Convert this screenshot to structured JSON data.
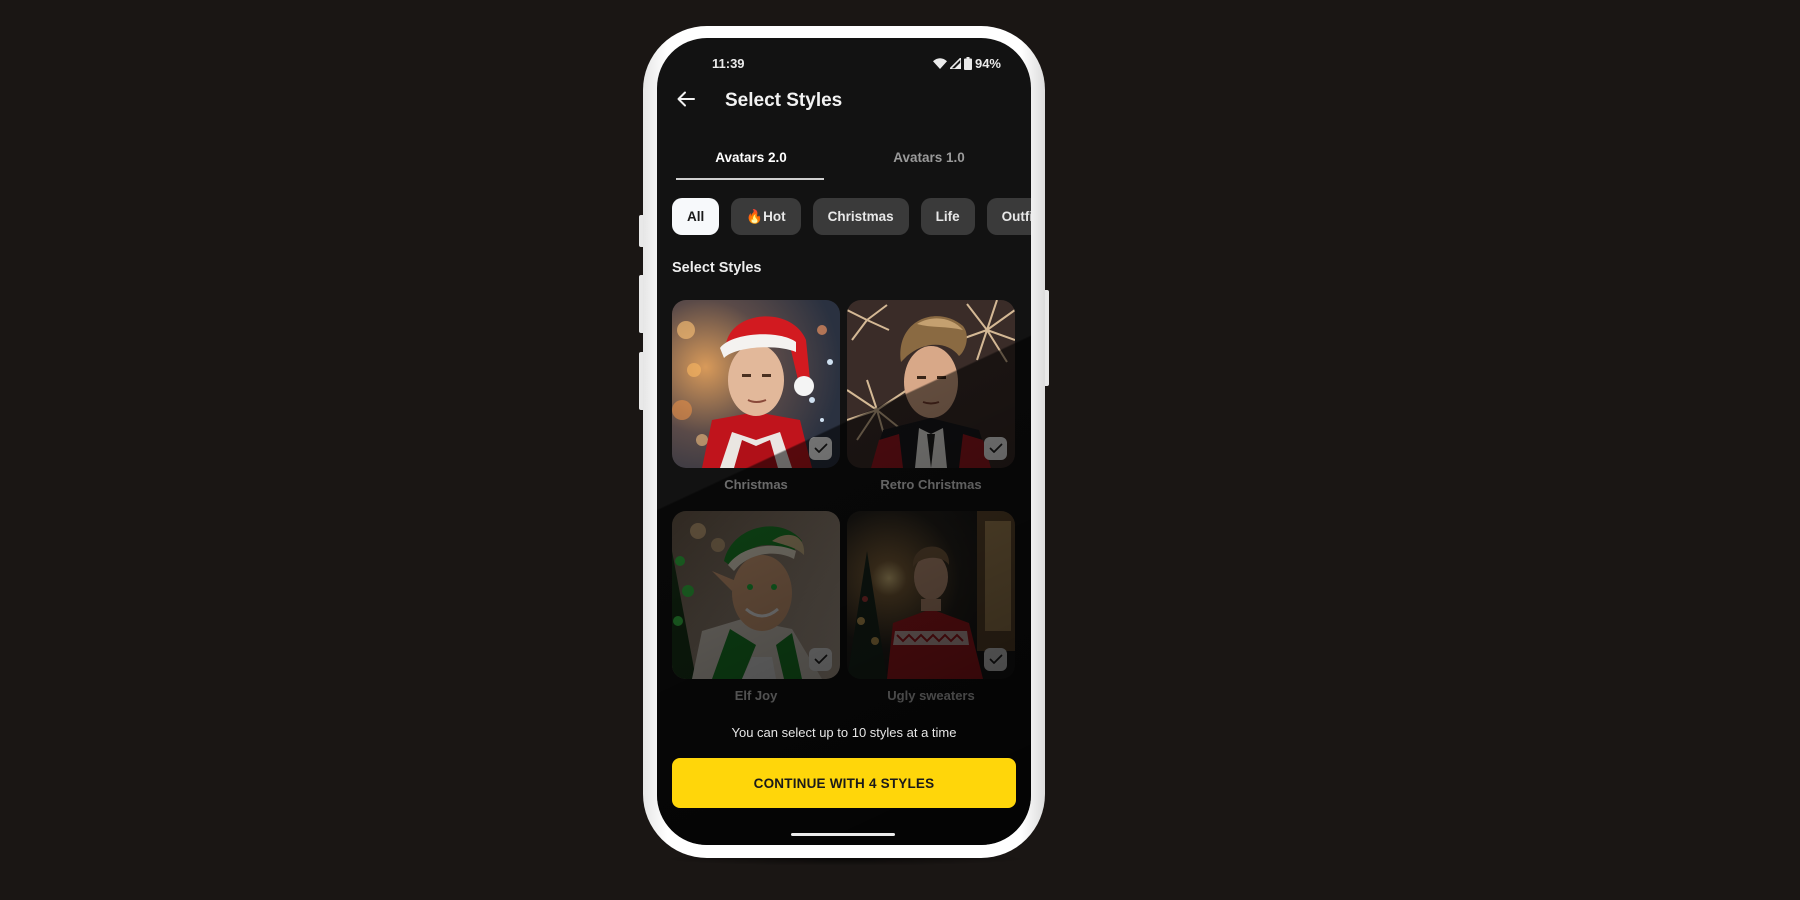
{
  "status_bar": {
    "time": "11:39",
    "battery": "94%",
    "icons": [
      "wifi-icon",
      "signal-icon",
      "battery-icon"
    ]
  },
  "header": {
    "back_icon": "arrow-left-icon",
    "title": "Select Styles"
  },
  "tabs": [
    {
      "label": "Avatars 2.0",
      "active": true
    },
    {
      "label": "Avatars 1.0",
      "active": false
    }
  ],
  "filters": [
    {
      "label": "All",
      "active": true
    },
    {
      "label": "🔥Hot",
      "active": false
    },
    {
      "label": "Christmas",
      "active": false
    },
    {
      "label": "Life",
      "active": false
    },
    {
      "label": "Outfit",
      "active": false
    }
  ],
  "section_label": "Select Styles",
  "styles": [
    {
      "label": "Christmas",
      "selected": true,
      "image": "man in santa hat with bokeh lights"
    },
    {
      "label": "Retro Christmas",
      "selected": true,
      "image": "man in suit with fireworks"
    },
    {
      "label": "Elf Joy",
      "selected": true,
      "image": "smiling elf with green hat"
    },
    {
      "label": "Ugly sweaters",
      "selected": true,
      "image": "man in red christmas sweater by tree"
    }
  ],
  "helper_text": "You can select up to 10 styles at a time",
  "cta": {
    "label": "CONTINUE WITH 4 STYLES"
  },
  "colors": {
    "accent": "#ffd60a",
    "background": "#121212",
    "chip": "#3a3a3a",
    "chip_active": "#f7f9fb",
    "page_background": "#1a1614"
  }
}
